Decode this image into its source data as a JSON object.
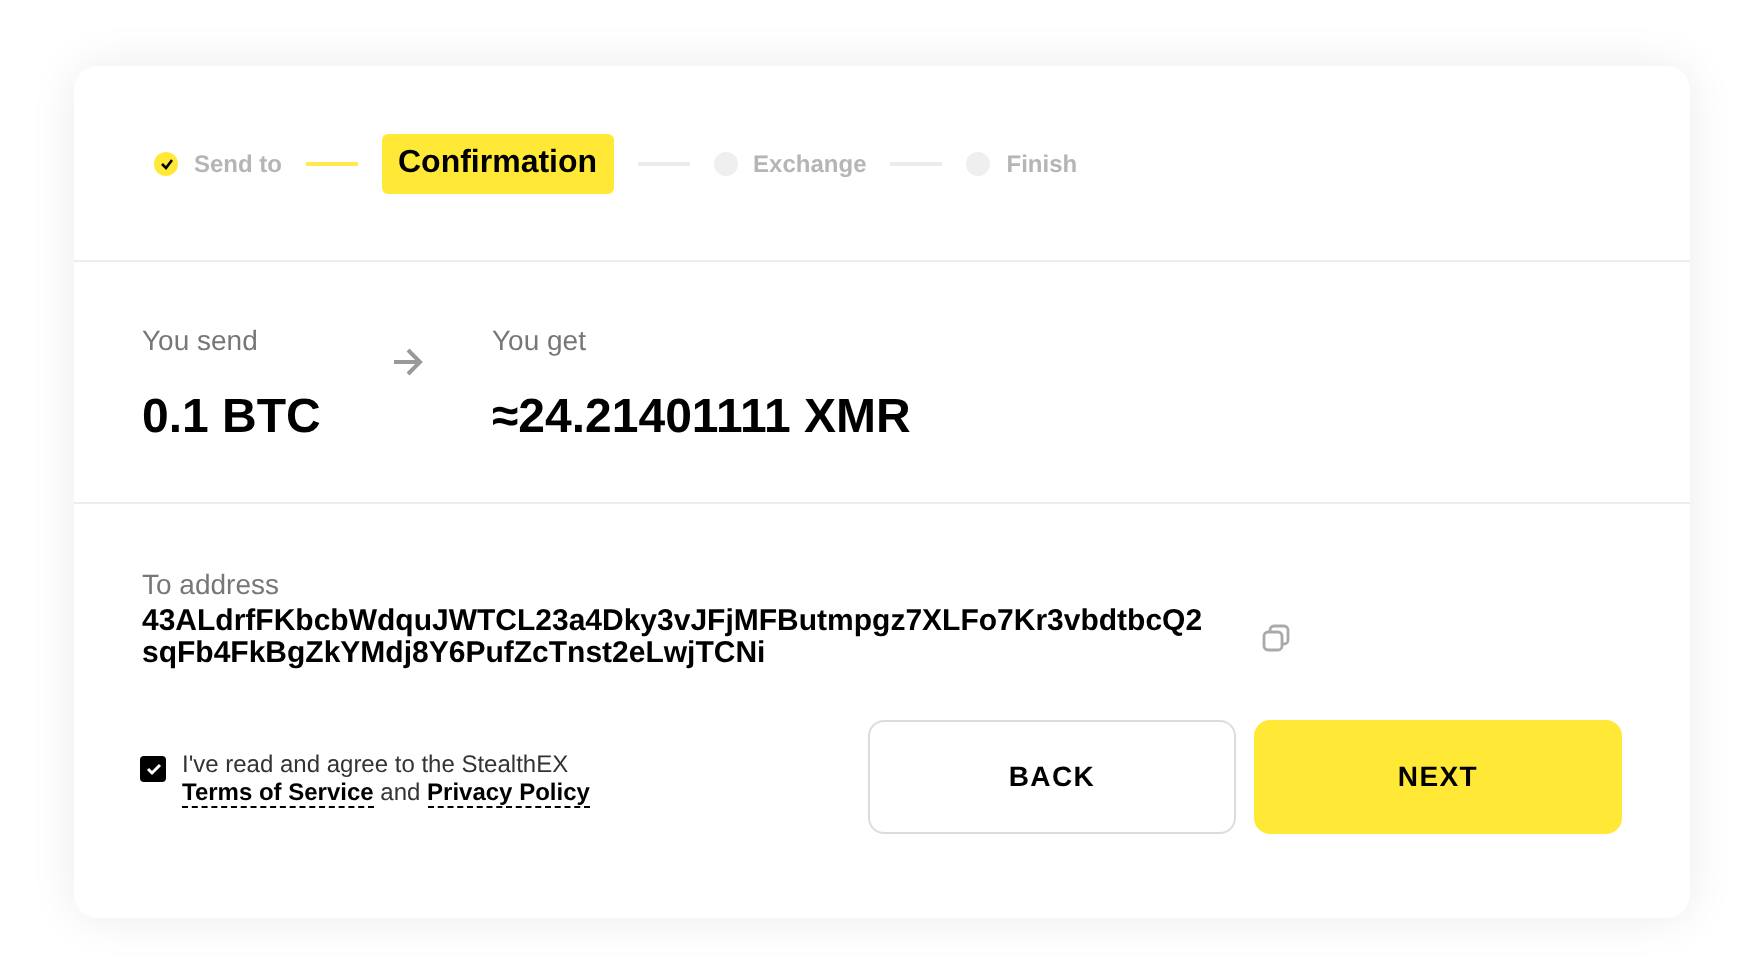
{
  "steps": [
    {
      "label": "Send to",
      "completed": true,
      "selected": false
    },
    {
      "label": "Confirmation",
      "completed": false,
      "selected": true
    },
    {
      "label": "Exchange",
      "completed": false,
      "selected": false
    },
    {
      "label": "Finish",
      "completed": false,
      "selected": false
    }
  ],
  "send": {
    "label": "You send",
    "amount": "0.1 BTC"
  },
  "get": {
    "label": "You get",
    "amount": "≈24.21401111 XMR"
  },
  "address": {
    "label": "To address",
    "value": "43ALdrfFKbcbWdquJWTCL23a4Dky3vJFjMFButmpgz7XLFo7Kr3vbdtbcQ2sqFb4FkBgZkYMdj8Y6PufZcTnst2eLwjTCNi"
  },
  "agreement": {
    "checked": true,
    "text": "I've read and agree to the StealthEX",
    "terms": "Terms of Service",
    "joiner": "and",
    "privacy": "Privacy Policy"
  },
  "buttons": [
    {
      "label": "BACK",
      "kind": "secondary"
    },
    {
      "label": "NEXT",
      "kind": "primary"
    }
  ]
}
